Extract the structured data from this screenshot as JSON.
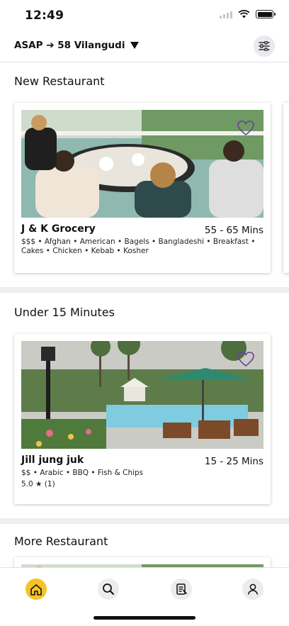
{
  "status_bar": {
    "time": "12:49"
  },
  "header": {
    "location": "ASAP ➔ 58 Vilangudi"
  },
  "sections": [
    {
      "title": "New Restaurant",
      "card": {
        "name": "J & K Grocery",
        "time": "55 - 65 Mins",
        "categories": "$$$ • Afghan • American • Bagels • Bangladeshi • Breakfast • Cakes • Chicken • Kebab • Kosher"
      }
    },
    {
      "title": "Under 15 Minutes",
      "card": {
        "name": "Jill jung juk",
        "time": "15 - 25 Mins",
        "categories": "$$ • Arabic • BBQ • Fish & Chips",
        "rating": "5.0 ★ (1)"
      }
    },
    {
      "title": "More Restaurant"
    }
  ],
  "icons": {
    "filter": "filter-icon",
    "heart": "heart-icon",
    "tabs": [
      "home-icon",
      "search-icon",
      "orders-icon",
      "profile-icon"
    ]
  },
  "colors": {
    "accent": "#f6c327",
    "heart_outline": "#6b3fa0"
  }
}
